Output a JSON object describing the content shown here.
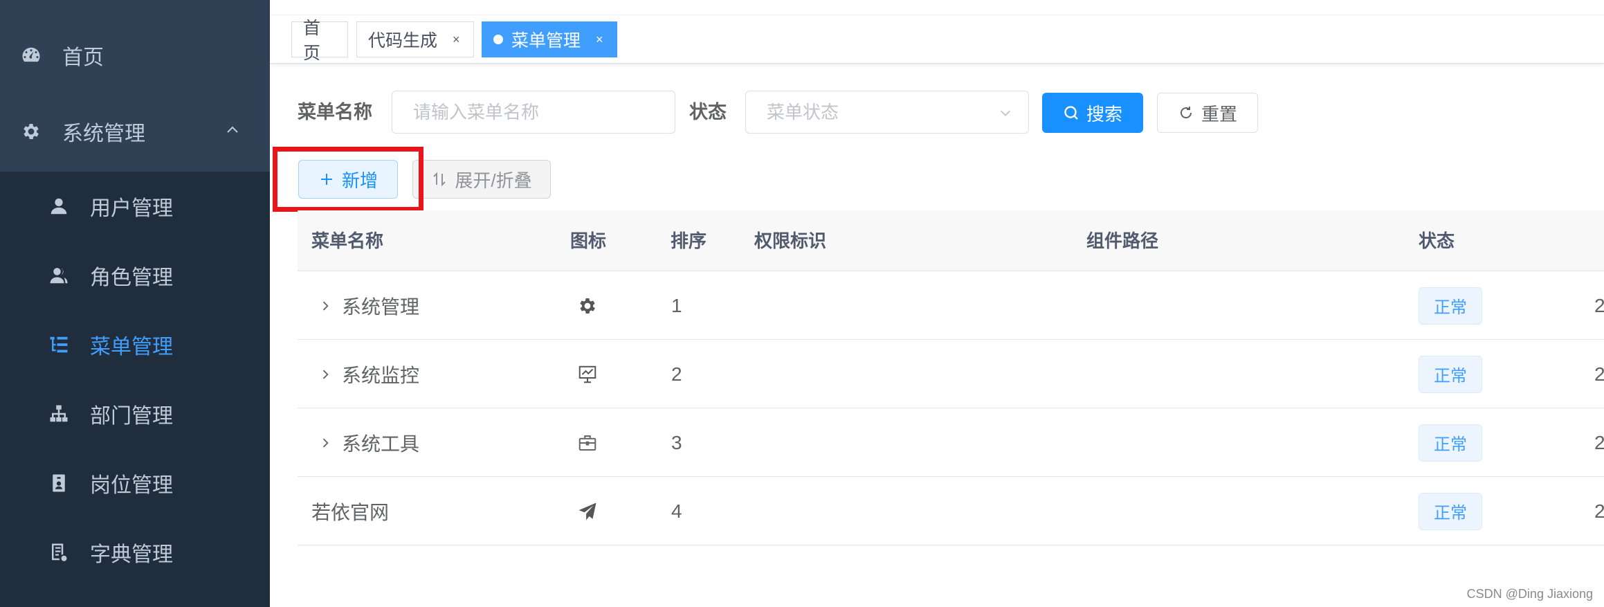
{
  "sidebar": {
    "home": "首页",
    "system": "系统管理",
    "items": [
      {
        "label": "用户管理",
        "icon": "user-icon"
      },
      {
        "label": "角色管理",
        "icon": "peoples-icon"
      },
      {
        "label": "菜单管理",
        "icon": "tree-table-icon",
        "active": true
      },
      {
        "label": "部门管理",
        "icon": "tree-icon"
      },
      {
        "label": "岗位管理",
        "icon": "post-icon"
      },
      {
        "label": "字典管理",
        "icon": "dict-icon"
      }
    ]
  },
  "tags": [
    {
      "label": "首页"
    },
    {
      "label": "代码生成",
      "close": "×"
    },
    {
      "label": "菜单管理",
      "close": "×",
      "active": true
    }
  ],
  "search": {
    "menu_name_label": "菜单名称",
    "menu_name_placeholder": "请输入菜单名称",
    "status_label": "状态",
    "status_placeholder": "菜单状态",
    "search_button": "搜索",
    "reset_button": "重置"
  },
  "toolbar": {
    "add_button": "新增",
    "expand_button": "展开/折叠"
  },
  "table": {
    "headers": [
      "菜单名称",
      "图标",
      "排序",
      "权限标识",
      "组件路径",
      "状态"
    ],
    "rows": [
      {
        "name": "系统管理",
        "icon": "system-gear-icon",
        "order": "1",
        "status": "正常",
        "expandable": true,
        "cut": "2"
      },
      {
        "name": "系统监控",
        "icon": "monitor-icon",
        "order": "2",
        "status": "正常",
        "expandable": true,
        "cut": "2"
      },
      {
        "name": "系统工具",
        "icon": "tool-box-icon",
        "order": "3",
        "status": "正常",
        "expandable": true,
        "cut": "2"
      },
      {
        "name": "若依官网",
        "icon": "guide-plane-icon",
        "order": "4",
        "status": "正常",
        "expandable": false,
        "cut": "2"
      }
    ]
  },
  "watermark": "CSDN @Ding Jiaxiong",
  "colors": {
    "sidebar_bg": "#1f2d3d",
    "sidebar_top_bg": "#304156",
    "accent": "#409eff",
    "primary_button": "#1890ff",
    "highlight": "#e8151b"
  }
}
